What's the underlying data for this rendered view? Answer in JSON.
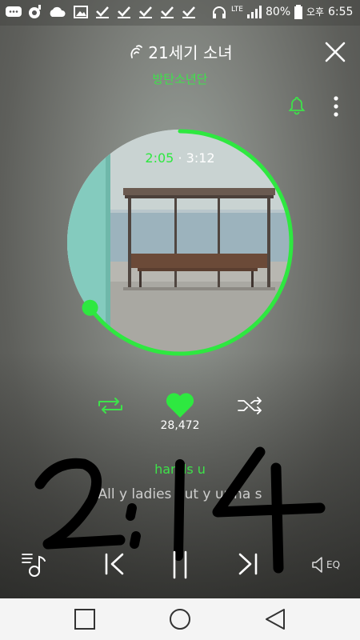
{
  "status_bar": {
    "battery_percent": "80%",
    "ampm": "오후",
    "time": "6:55",
    "network": "LTE"
  },
  "song": {
    "title": "21세기 소녀",
    "artist": "방탄소년단"
  },
  "playback": {
    "current": "2:05",
    "separator": "·",
    "total": "3:12",
    "progress_fraction": 0.65
  },
  "likes": "28,472",
  "lyrics": {
    "current_line": "hands u",
    "next_line": "All  y ladies put y ur ha  s"
  },
  "overlay_handwriting": "2:14",
  "controls": {
    "eq_label": "EQ"
  },
  "colors": {
    "accent_green": "#2ee840",
    "nav_bar": "#f4f4f4"
  },
  "icons": {
    "close": "close-icon",
    "bell": "bell-icon",
    "more": "more-vertical-icon",
    "repeat": "repeat-icon",
    "heart": "heart-icon",
    "shuffle": "shuffle-icon",
    "playlist": "playlist-icon",
    "prev": "previous-icon",
    "pause": "pause-icon",
    "next": "next-icon",
    "eq": "volume-eq-icon",
    "nav_recent": "recent-apps-icon",
    "nav_home": "home-icon",
    "nav_back": "back-icon"
  }
}
